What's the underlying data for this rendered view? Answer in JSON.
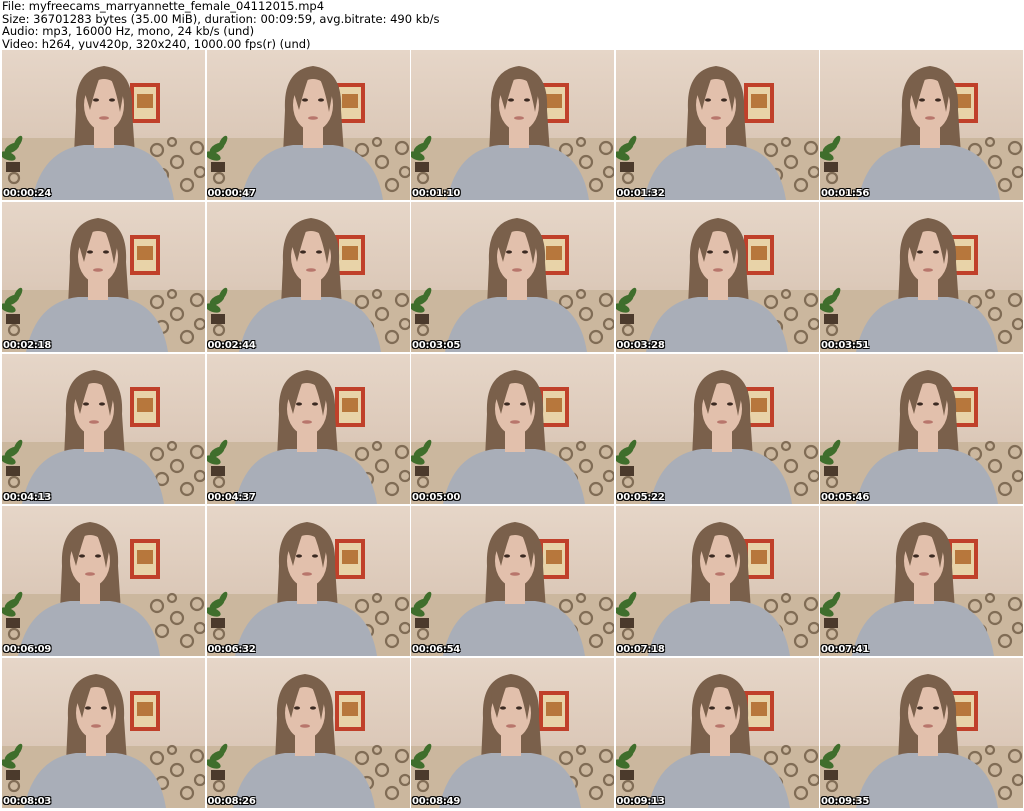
{
  "header": {
    "file_line": "File: myfreecams_marryannette_female_04112015.mp4",
    "size_line": "Size: 36701283 bytes (35.00 MiB), duration: 00:09:59, avg.bitrate: 490 kb/s",
    "audio_line": "Audio: mp3, 16000 Hz, mono, 24 kb/s (und)",
    "video_line": "Video: h264, yuv420p, 320x240, 1000.00 fps(r) (und)"
  },
  "timestamps": [
    "00:00:24",
    "00:00:47",
    "00:01:10",
    "00:01:32",
    "00:01:56",
    "00:02:18",
    "00:02:44",
    "00:03:05",
    "00:03:28",
    "00:03:51",
    "00:04:13",
    "00:04:37",
    "00:05:00",
    "00:05:22",
    "00:05:46",
    "00:06:09",
    "00:06:32",
    "00:06:54",
    "00:07:18",
    "00:07:41",
    "00:08:03",
    "00:08:26",
    "00:08:49",
    "00:09:13",
    "00:09:35"
  ],
  "colors": {
    "wall": "#e2d2c3",
    "couch": "#cbb79e",
    "couch_pattern": "#6e5a44",
    "sweater": "#a9aeb8",
    "hair": "#7a604b",
    "skin": "#e2c0ac",
    "frame": "#c0402a",
    "plant": "#3f6e2c"
  }
}
